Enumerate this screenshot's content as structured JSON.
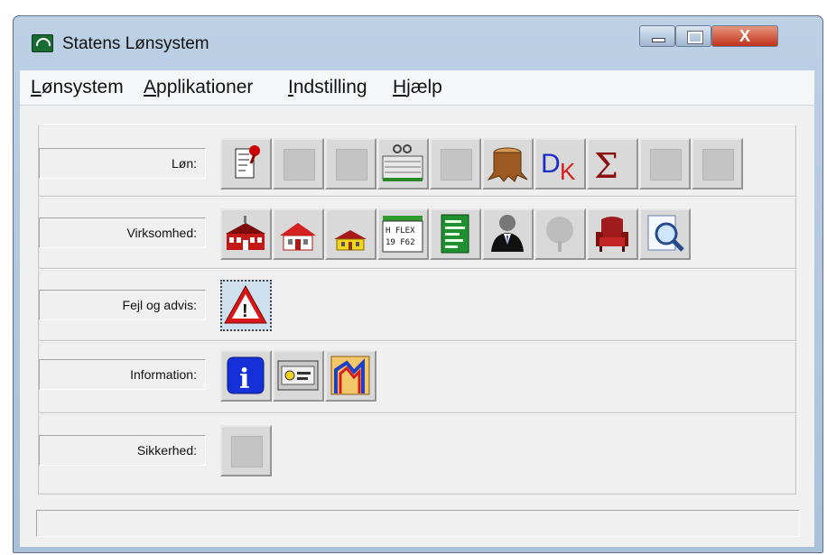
{
  "window": {
    "title": "Statens Lønsystem",
    "close_symbol": "X"
  },
  "menu": [
    {
      "label": "Lønsystem",
      "accel": "L",
      "rest": "ønsystem"
    },
    {
      "label": "Applikationer",
      "accel": "A",
      "rest": "pplikationer"
    },
    {
      "label": "Indstilling",
      "accel": "I",
      "rest": "ndstilling"
    },
    {
      "label": "Hjælp",
      "accel": "H",
      "rest": "jælp"
    }
  ],
  "groups": [
    {
      "label": "Løn:",
      "icons": [
        "document-pin-icon",
        "grid-icon-disabled",
        "chart-icon-disabled",
        "glasses-ledger-icon",
        "paper-stack-icon-disabled",
        "tree-stump-icon",
        "dk-icon",
        "sigma-icon",
        "building-icon-disabled",
        "office-icon-disabled"
      ]
    },
    {
      "label": "Virksomhed:",
      "icons": [
        "red-building-icon",
        "red-house-icon",
        "yellow-house-icon",
        "flex-icon",
        "green-list-icon",
        "person-suit-icon",
        "tree-icon-disabled",
        "armchair-icon",
        "magnifier-icon"
      ]
    },
    {
      "label": "Fejl og advis:",
      "icons": [
        "warning-icon"
      ]
    },
    {
      "label": "Information:",
      "icons": [
        "info-icon",
        "monitor-icon",
        "map-icon"
      ]
    },
    {
      "label": "Sikkerhed:",
      "icons": [
        "security-icon-disabled"
      ]
    }
  ],
  "icon_text": {
    "dk": "DK",
    "flex_line1": "H FLEX",
    "flex_line2": "19 F62",
    "info": "i",
    "warning": "!",
    "sigma": "Σ"
  }
}
